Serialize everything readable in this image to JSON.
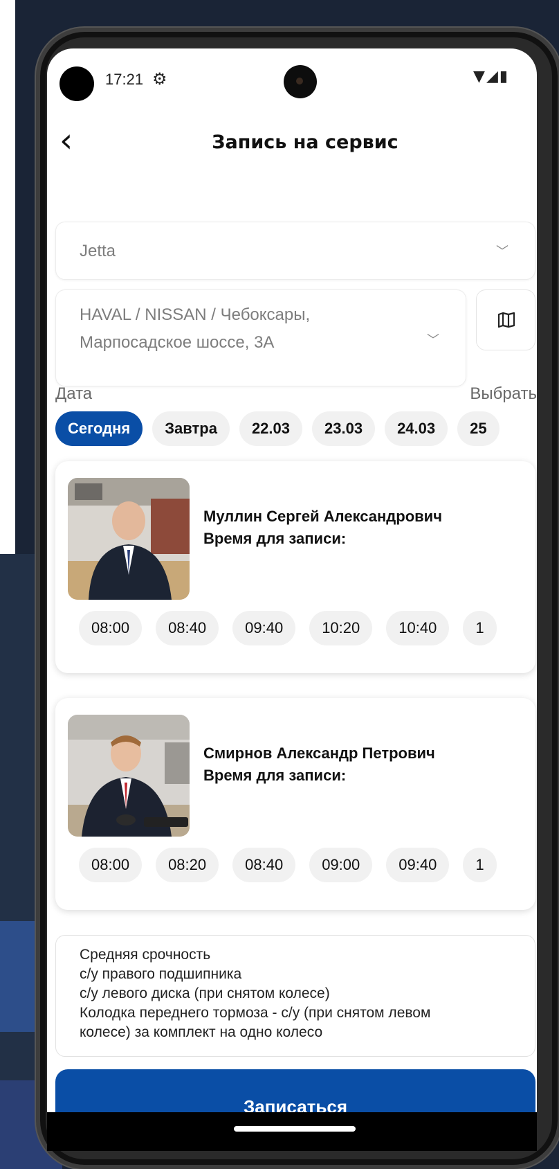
{
  "status_bar": {
    "time": "17:21",
    "settings_icon": "gear-icon",
    "indicators": "▼◢▮"
  },
  "header": {
    "back_icon": "back-arrow-icon",
    "title": "Запись на сервис"
  },
  "car_select": {
    "value": "Jetta"
  },
  "dealer_select": {
    "line1": "HAVAL / NISSAN / Чебоксары,",
    "line2": "Марпосадское шоссе, 3А"
  },
  "date_section": {
    "label": "Дата",
    "pick_label": "Выбрать",
    "chips": [
      "Сегодня",
      "Завтра",
      "22.03",
      "23.03",
      "24.03",
      "25"
    ],
    "selected_index": 0
  },
  "specialists": [
    {
      "name": "Муллин Сергей Александрович",
      "time_label": "Время для записи:",
      "slots": [
        "08:00",
        "08:40",
        "09:40",
        "10:20",
        "10:40",
        "1"
      ]
    },
    {
      "name": "Смирнов Александр Петрович",
      "time_label": "Время для записи:",
      "slots": [
        "08:00",
        "08:20",
        "08:40",
        "09:00",
        "09:40",
        "1"
      ]
    }
  ],
  "comment": {
    "lines": [
      "Средняя срочность",
      "с/у правого подшипника",
      "с/у левого диска (при снятом колесе)",
      "Колодка переднего тормоза - с/у (при снятом левом",
      "колесе) за комплект на одно колесо"
    ]
  },
  "submit": {
    "label": "Записаться"
  },
  "colors": {
    "accent": "#0a4ea6",
    "chip_bg": "#f1f1f1"
  }
}
